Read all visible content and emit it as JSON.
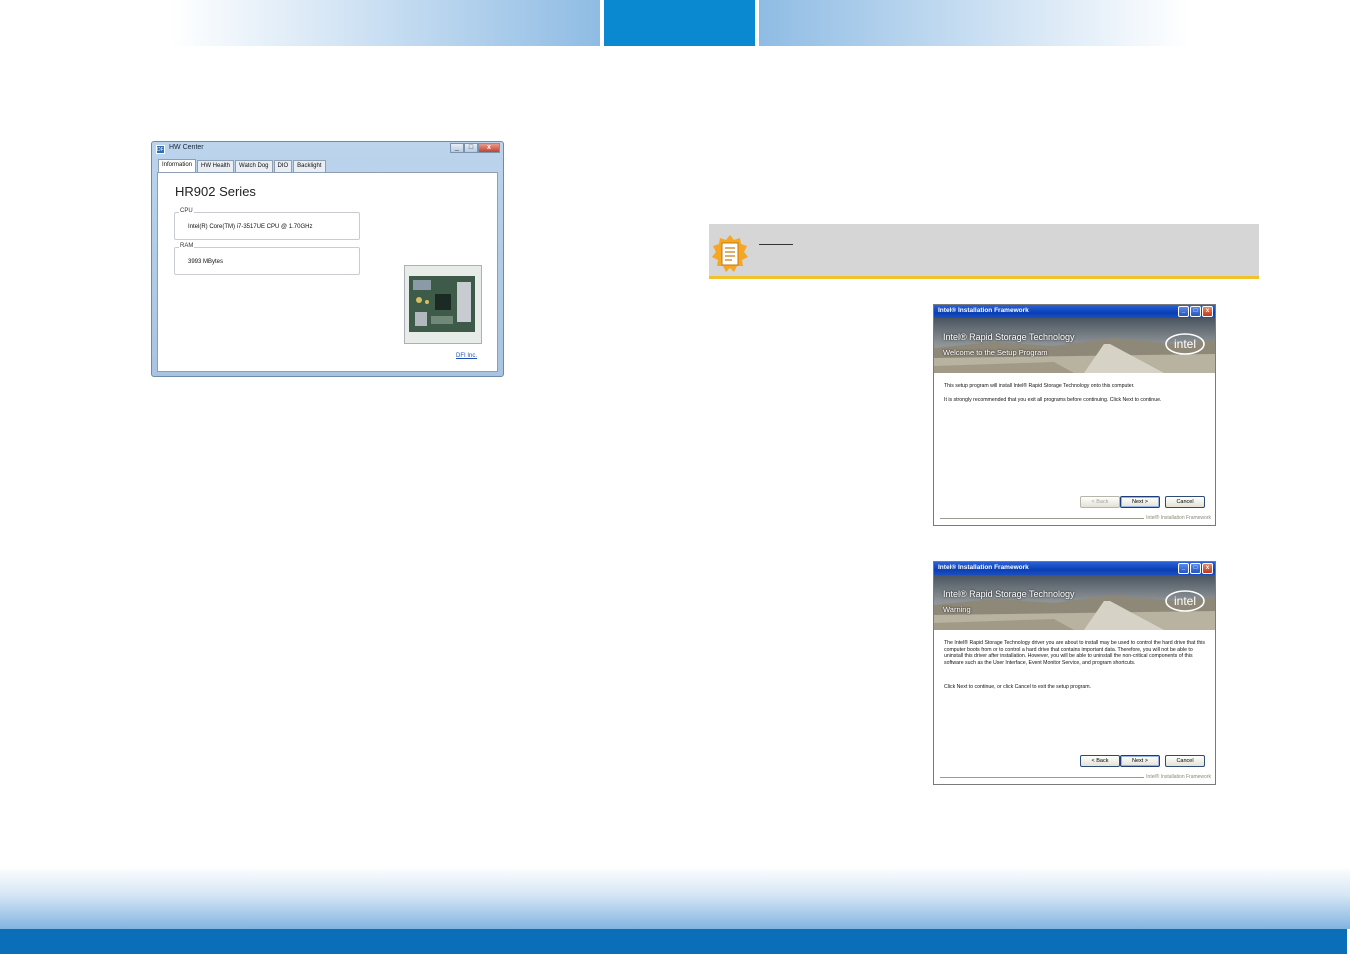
{
  "hw_center": {
    "title": "HW Center",
    "app_icon_text": "DFI",
    "tabs": [
      {
        "label": "Information"
      },
      {
        "label": "HW Health"
      },
      {
        "label": "Watch Dog"
      },
      {
        "label": "DIO"
      },
      {
        "label": "Backlight"
      }
    ],
    "active_tab": "Information",
    "series_title": "HR902 Series",
    "cpu": {
      "label": "CPU",
      "value": "Intel(R) Core(TM) i7-3517UE CPU @ 1.70GHz"
    },
    "ram": {
      "label": "RAM",
      "value": "3993 MBytes"
    },
    "link": "DFI Inc.",
    "controls": {
      "minimize": "_",
      "maximize": "□",
      "close": "x"
    }
  },
  "intel_welcome": {
    "window_title": "Intel® Installation Framework",
    "product": "Intel® Rapid Storage Technology",
    "subtitle": "Welcome to the Setup Program",
    "logo": "intel",
    "paragraphs": [
      "This setup program will install Intel® Rapid Storage Technology onto this computer.",
      "It is strongly recommended that you exit all programs before continuing. Click Next to continue."
    ],
    "buttons": {
      "back": "< Back",
      "next": "Next >",
      "cancel": "Cancel"
    },
    "back_enabled": false,
    "footer": "Intel® Installation Framework"
  },
  "intel_warning": {
    "window_title": "Intel® Installation Framework",
    "product": "Intel® Rapid Storage Technology",
    "subtitle": "Warning",
    "logo": "intel",
    "paragraphs": [
      "The Intel® Rapid Storage Technology driver you are about to install may be used to control the hard drive that this computer boots from or to control a hard drive that contains important data. Therefore, you will not be able to uninstall this driver after installation. However, you will be able to uninstall the non-critical components of this software such as the User Interface, Event Monitor Service, and program shortcuts.",
      "Click Next to continue, or click Cancel to exit the setup program."
    ],
    "buttons": {
      "back": "< Back",
      "next": "Next >",
      "cancel": "Cancel"
    },
    "back_enabled": true,
    "footer": "Intel® Installation Framework"
  },
  "xp_controls": {
    "minimize": "_",
    "maximize": "□",
    "close": "x"
  },
  "colors": {
    "header_blue": "#0a88d0",
    "footer_blue": "#0a6fb8",
    "note_gray": "#d6d6d6",
    "note_accent": "#f2c22d",
    "xp_title_blue": "#0a3fb5"
  },
  "icons": {
    "note": "note-memo-icon",
    "photo": "motherboard-photo"
  }
}
